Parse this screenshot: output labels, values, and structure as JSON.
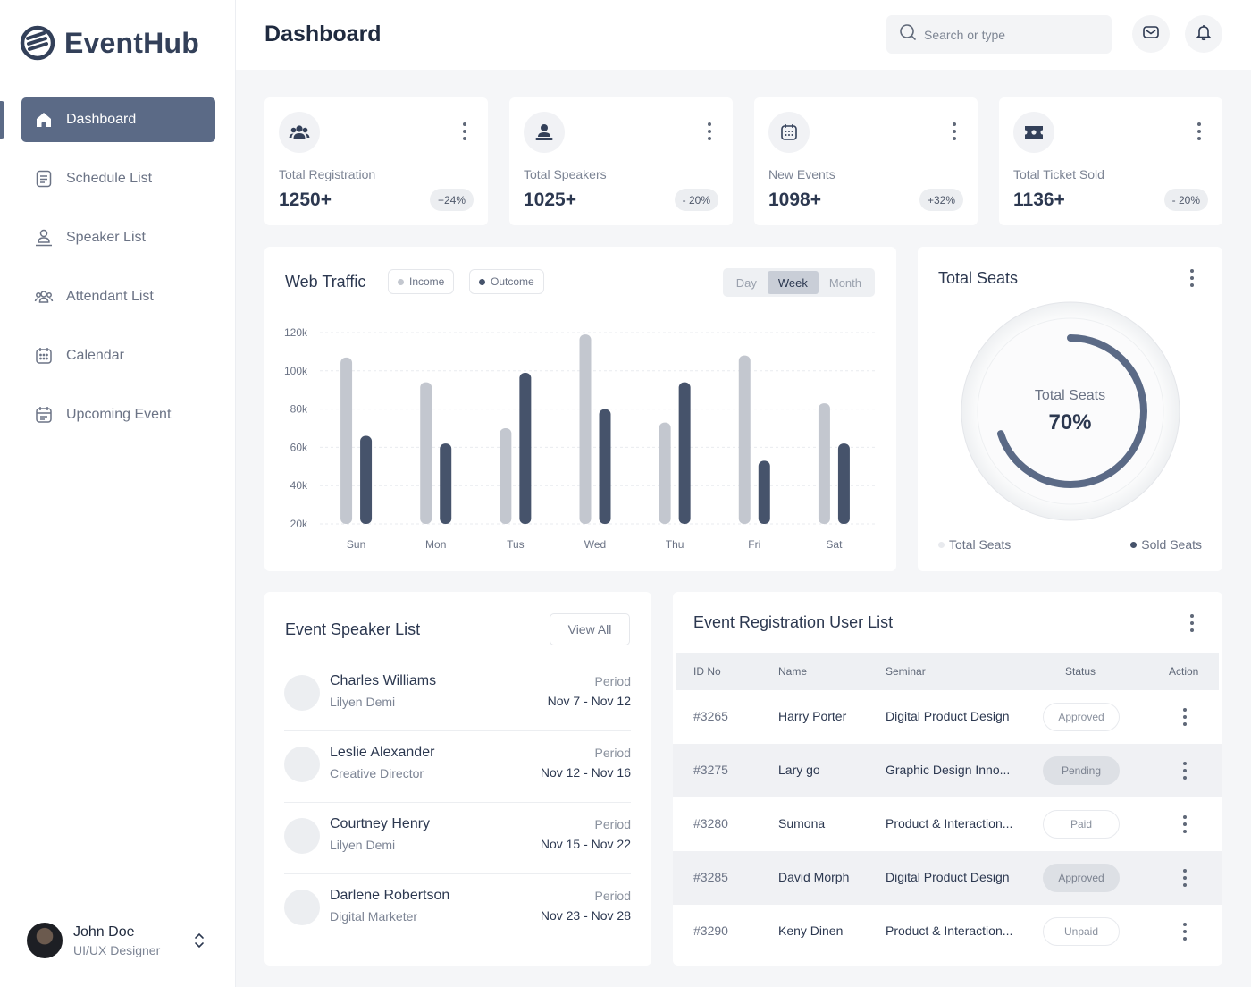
{
  "app": {
    "name": "EventHub"
  },
  "sidebar": {
    "items": [
      {
        "label": "Dashboard",
        "icon": "home-icon",
        "active": true
      },
      {
        "label": "Schedule List",
        "icon": "clipboard-icon"
      },
      {
        "label": "Speaker List",
        "icon": "speaker-icon"
      },
      {
        "label": "Attendant List",
        "icon": "users-icon"
      },
      {
        "label": "Calendar",
        "icon": "calendar-icon"
      },
      {
        "label": "Upcoming Event",
        "icon": "calendar-event-icon"
      }
    ],
    "user": {
      "name": "John Doe",
      "role": "UI/UX Designer"
    }
  },
  "header": {
    "title": "Dashboard",
    "search_placeholder": "Search or type"
  },
  "stats": [
    {
      "label": "Total Registration",
      "value": "1250+",
      "change": "+24%",
      "icon": "users-group-icon"
    },
    {
      "label": "Total Speakers",
      "value": "1025+",
      "change": "- 20%",
      "icon": "speaker-podium-icon"
    },
    {
      "label": "New Events",
      "value": "1098+",
      "change": "+32%",
      "icon": "calendar-grid-icon"
    },
    {
      "label": "Total Ticket Sold",
      "value": "1136+",
      "change": "- 20%",
      "icon": "ticket-icon"
    }
  ],
  "traffic": {
    "title": "Web Traffic",
    "legend_income": "Income",
    "legend_outcome": "Outcome",
    "tabs": [
      "Day",
      "Week",
      "Month"
    ],
    "active_tab": "Week"
  },
  "chart_data": {
    "type": "bar",
    "title": "Web Traffic",
    "categories": [
      "Sun",
      "Mon",
      "Tus",
      "Wed",
      "Thu",
      "Fri",
      "Sat"
    ],
    "series": [
      {
        "name": "Income",
        "color": "#c3c7cf",
        "values": [
          107000,
          94000,
          70000,
          119000,
          73000,
          108000,
          83000
        ]
      },
      {
        "name": "Outcome",
        "color": "#46536b",
        "values": [
          66000,
          62000,
          99000,
          80000,
          94000,
          53000,
          62000
        ]
      }
    ],
    "y_ticks": [
      "120k",
      "100k",
      "80k",
      "60k",
      "40k",
      "20k"
    ],
    "ylim": [
      20000,
      120000
    ],
    "grid": true
  },
  "seats": {
    "title": "Total Seats",
    "center_label": "Total Seats",
    "percent_text": "70%",
    "percent": 70,
    "legend_total": "Total Seats",
    "legend_sold": "Sold Seats"
  },
  "speakers": {
    "title": "Event Speaker List",
    "view_all": "View All",
    "period_label": "Period",
    "items": [
      {
        "name": "Charles Williams",
        "role": "Lilyen Demi",
        "period": "Nov 7 - Nov 12"
      },
      {
        "name": "Leslie Alexander",
        "role": "Creative Director",
        "period": "Nov 12 - Nov 16"
      },
      {
        "name": "Courtney Henry",
        "role": "Lilyen Demi",
        "period": "Nov 15 - Nov 22"
      },
      {
        "name": "Darlene Robertson",
        "role": "Digital Marketer",
        "period": "Nov 23 - Nov 28"
      }
    ]
  },
  "registrations": {
    "title": "Event Registration User List",
    "columns": [
      "ID No",
      "Name",
      "Seminar",
      "Status",
      "Action"
    ],
    "rows": [
      {
        "id": "#3265",
        "name": "Harry Porter",
        "seminar": "Digital Product Design",
        "status": "Approved"
      },
      {
        "id": "#3275",
        "name": "Lary go",
        "seminar": "Graphic Design Inno...",
        "status": "Pending"
      },
      {
        "id": "#3280",
        "name": "Sumona",
        "seminar": "Product & Interaction...",
        "status": "Paid"
      },
      {
        "id": "#3285",
        "name": "David Morph",
        "seminar": "Digital Product Design",
        "status": "Approved"
      },
      {
        "id": "#3290",
        "name": "Keny Dinen",
        "seminar": "Product & Interaction...",
        "status": "Unpaid"
      }
    ]
  }
}
